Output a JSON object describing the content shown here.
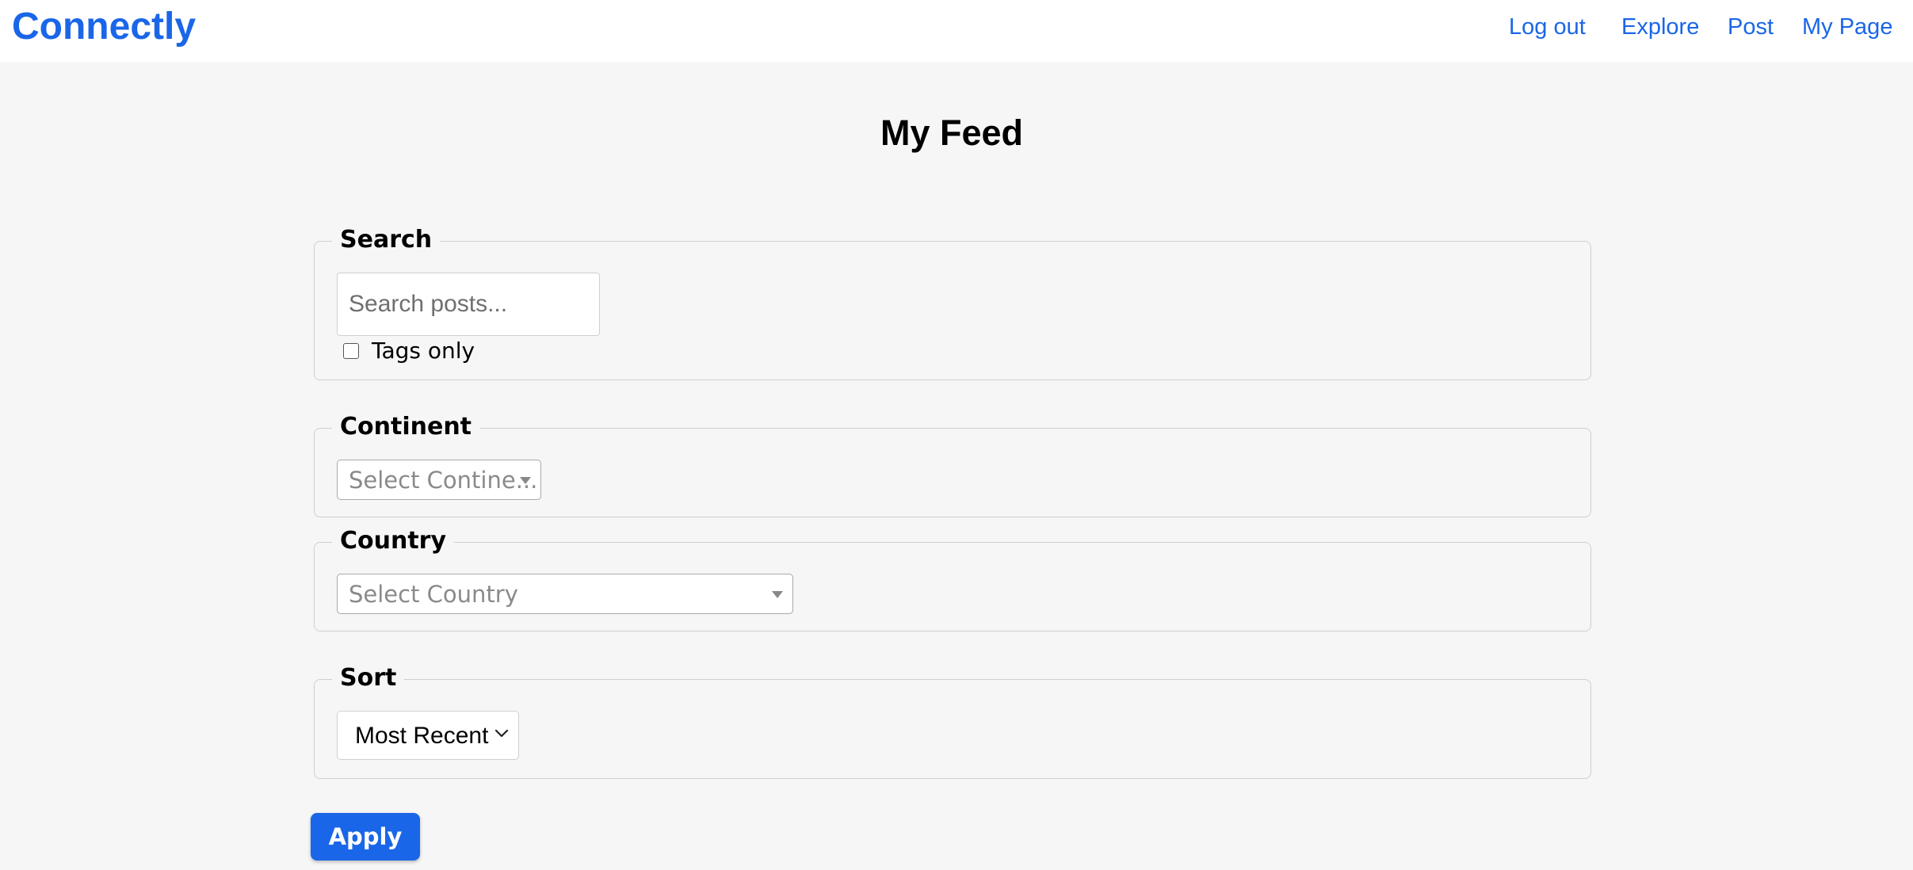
{
  "header": {
    "brand": "Connectly",
    "nav": {
      "logout": "Log out",
      "explore": "Explore",
      "post": "Post",
      "my_page": "My Page"
    }
  },
  "main": {
    "title": "My Feed",
    "search": {
      "legend": "Search",
      "placeholder": "Search posts...",
      "value": "",
      "tags_only_label": "Tags only",
      "tags_only_checked": false
    },
    "continent": {
      "legend": "Continent",
      "placeholder": "Select Contine..."
    },
    "country": {
      "legend": "Country",
      "placeholder": "Select Country"
    },
    "sort": {
      "legend": "Sort",
      "selected": "Most Recent"
    },
    "apply_label": "Apply"
  },
  "colors": {
    "accent": "#1a66e8",
    "page_background": "#f6f6f6",
    "header_background": "#ffffff"
  },
  "icons": {
    "continent_dropdown": "caret-down-icon",
    "country_dropdown": "caret-down-icon",
    "sort_dropdown": "chevron-down-icon"
  }
}
